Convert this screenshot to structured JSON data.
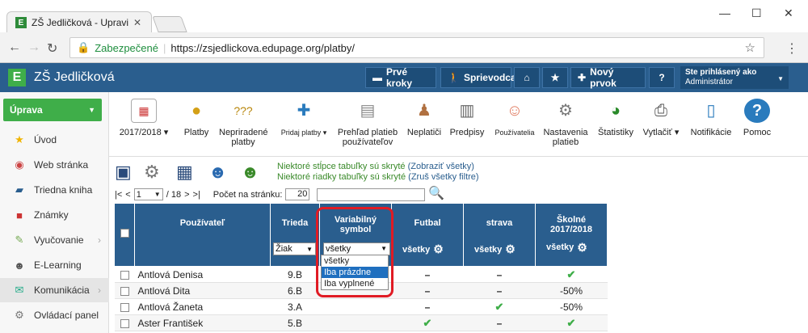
{
  "browser": {
    "tab_title": "ZŠ Jedličková - Upraviť vz",
    "secure_label": "Zabezpečené",
    "url": "https://zsjedlickova.edupage.org/platby/"
  },
  "app": {
    "title": "ZŠ Jedličková",
    "header_buttons": [
      "Prvé kroky",
      "Sprievodca",
      "Nový prvok",
      "?"
    ],
    "user_label": "Ste prihlásený ako",
    "user_name": "Administrátor"
  },
  "sidebar": {
    "section": "Úprava",
    "items": [
      {
        "label": "Úvod",
        "icon": "star-icon"
      },
      {
        "label": "Web stránka",
        "icon": "globe-icon"
      },
      {
        "label": "Triedna kniha",
        "icon": "book-icon"
      },
      {
        "label": "Známky",
        "icon": "grades-icon"
      },
      {
        "label": "Vyučovanie",
        "icon": "teaching-icon"
      },
      {
        "label": "E-Learning",
        "icon": "elearning-icon"
      },
      {
        "label": "Komunikácia",
        "icon": "communication-icon"
      },
      {
        "label": "Ovládací panel",
        "icon": "control-panel-icon"
      }
    ]
  },
  "toolbar": {
    "items": [
      {
        "label": "2017/2018",
        "icon": "calendar-icon"
      },
      {
        "label": "Platby",
        "icon": "coins-icon"
      },
      {
        "label": "Nepriradené platby",
        "icon": "unassigned-icon"
      },
      {
        "label": "Pridaj platby",
        "icon": "add-payments-icon"
      },
      {
        "label": "Prehľad platieb používateľov",
        "icon": "overview-icon"
      },
      {
        "label": "Neplatiči",
        "icon": "nonpayers-icon"
      },
      {
        "label": "Predpisy",
        "icon": "documents-icon"
      },
      {
        "label": "Používatelia",
        "icon": "users-icon"
      },
      {
        "label": "Nastavenia platieb",
        "icon": "settings-icon"
      },
      {
        "label": "Štatistiky",
        "icon": "statistics-icon"
      },
      {
        "label": "Vytlačiť",
        "icon": "print-icon"
      },
      {
        "label": "Notifikácie",
        "icon": "notifications-icon"
      },
      {
        "label": "Pomoc",
        "icon": "help-icon"
      }
    ]
  },
  "notice": {
    "cols_hidden": "Niektoré stĺpce tabuľky sú skryté",
    "show_all": "(Zobraziť všetky)",
    "rows_hidden": "Niektoré riadky tabuľky sú skryté",
    "clear_filters": "(Zruš všetky filtre)"
  },
  "pager": {
    "first": "|<",
    "prev": "<",
    "page": "1",
    "total": "/ 18",
    "next": ">",
    "last": ">|",
    "per_page_label": "Počet na stránku:",
    "per_page": "20"
  },
  "grid": {
    "headers": {
      "user": "Používateľ",
      "class": "Trieda",
      "varsym": "Variabilný symbol",
      "futbal": "Futbal",
      "strava": "strava",
      "skolne": "Školné 2017/2018"
    },
    "filters": {
      "class": "Žiak",
      "varsym": "všetky",
      "futbal": "všetky",
      "strava": "všetky",
      "skolne": "všetky"
    },
    "dropdown_options": [
      "všetky",
      "Iba prázdne",
      "Iba vyplnené"
    ],
    "rows": [
      {
        "name": "Antlová Denisa",
        "class": "9.B",
        "futbal": "–",
        "strava": "–",
        "skolne": "✔"
      },
      {
        "name": "Antlová Dita",
        "class": "6.B",
        "futbal": "–",
        "strava": "–",
        "skolne": "-50%"
      },
      {
        "name": "Antlová Žaneta",
        "class": "3.A",
        "futbal": "–",
        "strava": "✔",
        "skolne": "-50%"
      },
      {
        "name": "Aster František",
        "class": "5.B",
        "futbal": "✔",
        "strava": "–",
        "skolne": "✔"
      }
    ]
  }
}
